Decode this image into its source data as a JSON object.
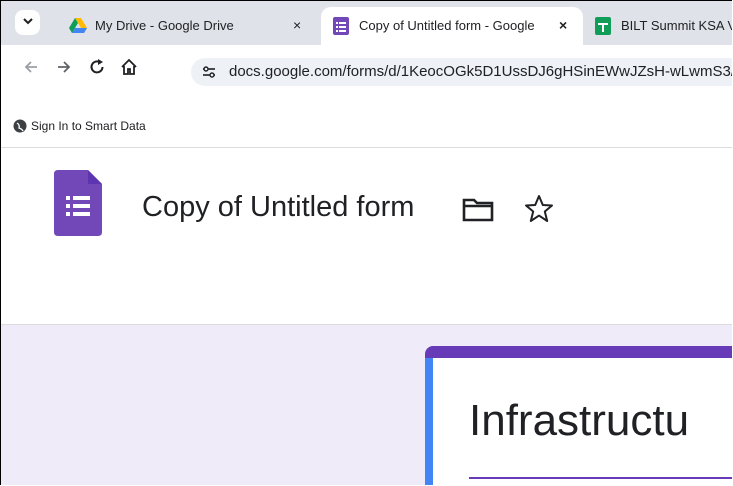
{
  "browser": {
    "tabs": [
      {
        "title": "My Drive - Google Drive",
        "close": "×"
      },
      {
        "title": "Copy of Untitled form - Google",
        "close": "×"
      },
      {
        "title": "BILT Summit KSA V",
        "close": ""
      }
    ],
    "url": "docs.google.com/forms/d/1KeocOGk5D1UssDJ6gHSinEWwJZsH-wLwmS3/",
    "bookmarks": [
      {
        "label": "Sign In to Smart Data"
      }
    ]
  },
  "forms": {
    "doc_title": "Copy of Untitled form",
    "header_title": "Infrastructu",
    "colors": {
      "accent": "#673ab7",
      "icon": "#7248b9",
      "canvas": "#f0ebf8",
      "left_bar": "#4285f4"
    }
  }
}
